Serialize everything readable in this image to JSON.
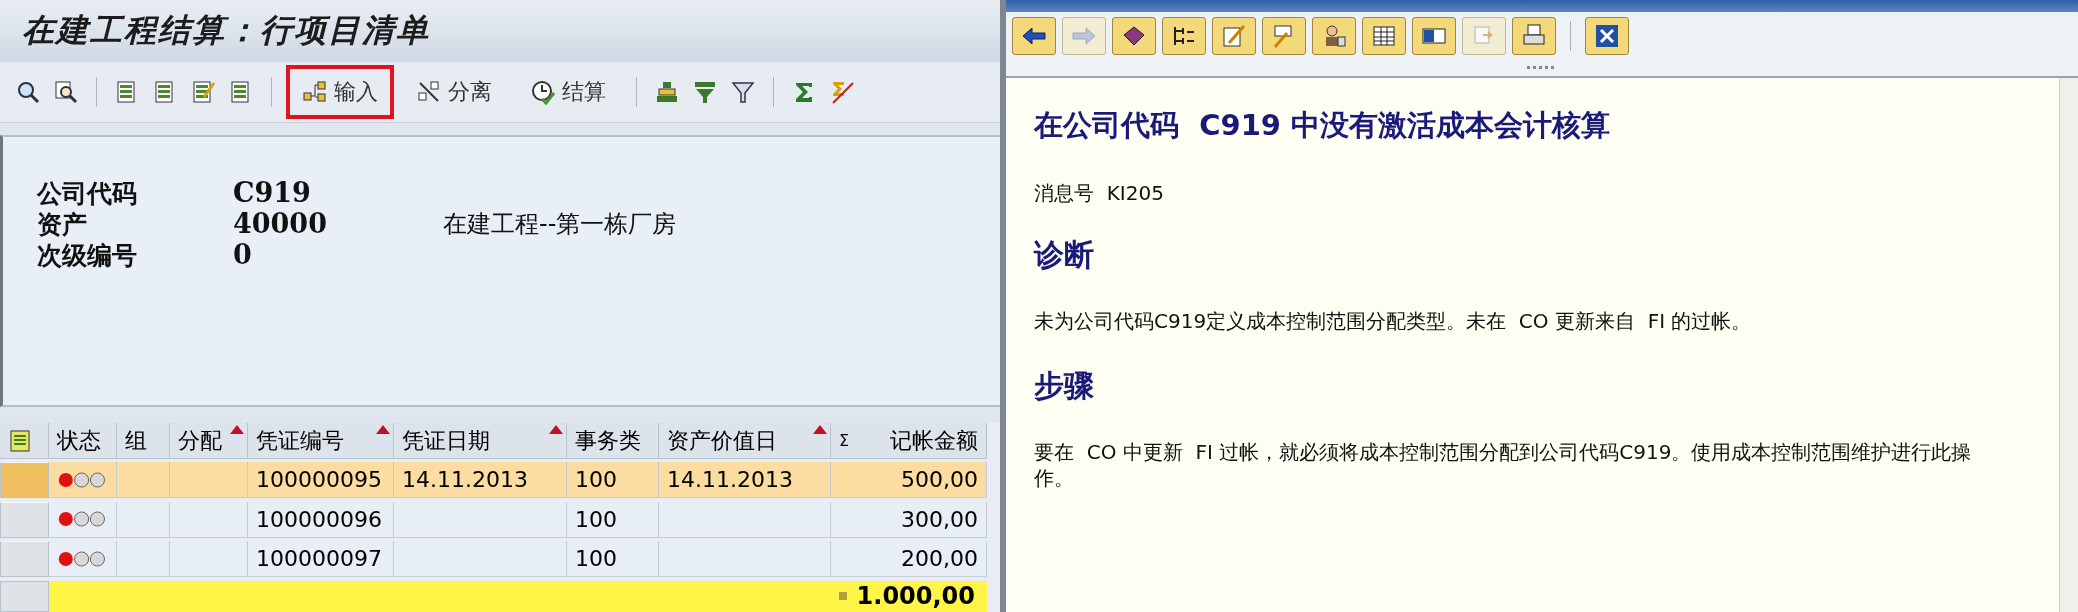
{
  "main": {
    "title": "在建工程结算：行项目清单",
    "toolbar": [
      {
        "kind": "icon"
      },
      {
        "kind": "icon"
      },
      {
        "kind": "separator"
      },
      {
        "kind": "icon"
      },
      {
        "kind": "icon"
      },
      {
        "kind": "icon"
      },
      {
        "kind": "icon"
      },
      {
        "kind": "separator"
      },
      {
        "kind": "button",
        "label": "输入",
        "highlighted": true
      },
      {
        "kind": "button",
        "label": "分离",
        "highlighted": false
      },
      {
        "kind": "button",
        "label": "结算",
        "highlighted": false
      },
      {
        "kind": "separator"
      },
      {
        "kind": "icon"
      },
      {
        "kind": "icon"
      },
      {
        "kind": "icon"
      },
      {
        "kind": "separator"
      },
      {
        "kind": "icon"
      },
      {
        "kind": "icon"
      }
    ],
    "header": [
      {
        "label": "公司代码",
        "value": "C919"
      },
      {
        "label": "资产",
        "value": "40000",
        "description": "在建工程--第一栋厂房"
      },
      {
        "label": "次级编号",
        "value": "0"
      }
    ],
    "table": {
      "columns": [
        {
          "label": "状态",
          "sorted": false
        },
        {
          "label": "组",
          "sorted": false
        },
        {
          "label": "分配",
          "sorted": true
        },
        {
          "label": "凭证编号",
          "sorted": true
        },
        {
          "label": "凭证日期",
          "sorted": true
        },
        {
          "label": "事务类",
          "sorted": false
        },
        {
          "label": "资产价值日",
          "sorted": true
        },
        {
          "label": "记帐金额",
          "sorted": false,
          "sigma": "Σ"
        }
      ],
      "rows": [
        {
          "selected": true,
          "color": "#e01010",
          "cells": [
            "",
            "",
            "",
            "100000095",
            "14.11.2013",
            "100",
            "14.11.2013",
            "500,00"
          ]
        },
        {
          "selected": false,
          "color": "#e01010",
          "cells": [
            "",
            "",
            "",
            "100000096",
            "",
            "100",
            "",
            "300,00"
          ]
        },
        {
          "selected": false,
          "color": "#e01010",
          "cells": [
            "",
            "",
            "",
            "100000097",
            "",
            "100",
            "",
            "200,00"
          ]
        }
      ],
      "total": "1.000,00"
    }
  },
  "assistant": {
    "toolbar": [
      {
        "kind": "button",
        "disabled": false
      },
      {
        "kind": "button",
        "disabled": true
      },
      {
        "kind": "button",
        "disabled": false
      },
      {
        "kind": "button",
        "disabled": false
      },
      {
        "kind": "button",
        "disabled": false
      },
      {
        "kind": "button",
        "disabled": false
      },
      {
        "kind": "button",
        "disabled": false
      },
      {
        "kind": "button",
        "disabled": false
      },
      {
        "kind": "button",
        "disabled": false
      },
      {
        "kind": "button",
        "disabled": true
      },
      {
        "kind": "button",
        "disabled": false
      },
      {
        "kind": "separator"
      },
      {
        "kind": "close",
        "disabled": false
      }
    ],
    "heading": "在公司代码  C919 中没有激活成本会计核算",
    "message_no": "消息号  KI205",
    "sections": [
      {
        "title": "诊断",
        "text": "未为公司代码C919定义成本控制范围分配类型。未在  CO 更新来自  FI 的过帐。"
      },
      {
        "title": "步骤",
        "text": "要在  CO 中更新  FI 过帐，就必须将成本控制范围分配到公司代码C919。使用成本控制范围维护进行此操作。"
      }
    ]
  }
}
